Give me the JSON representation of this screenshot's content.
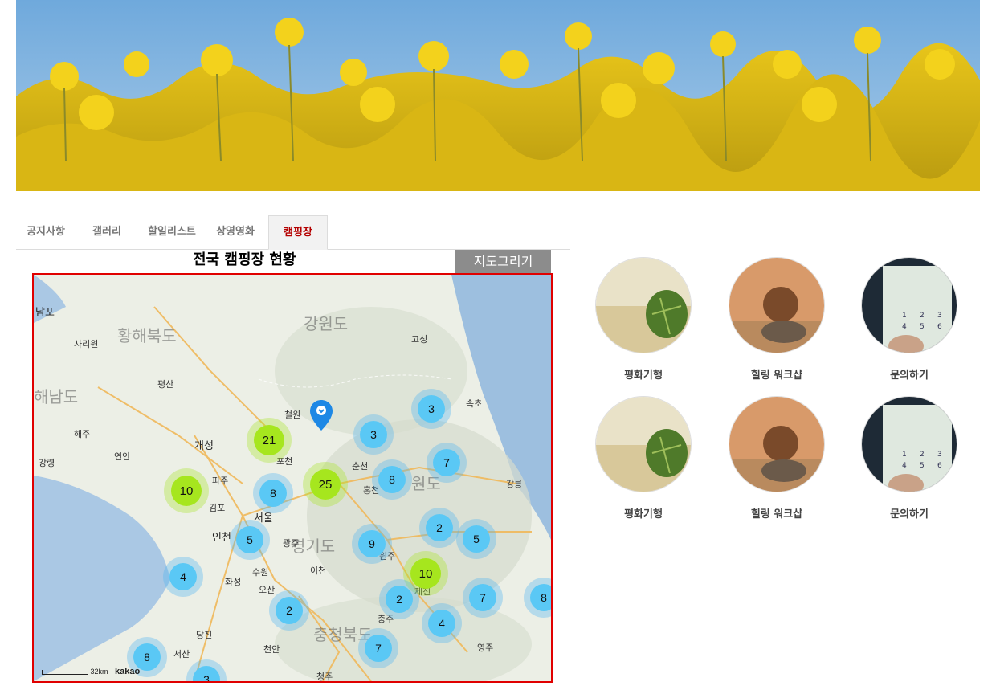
{
  "tabs": [
    {
      "label": "공지사항"
    },
    {
      "label": "갤러리"
    },
    {
      "label": "할일리스트"
    },
    {
      "label": "상영영화"
    },
    {
      "label": "캠핑장",
      "active": true
    }
  ],
  "map_section": {
    "title": "전국 캠핑장 현황",
    "draw_button": "지도그리기"
  },
  "map": {
    "provider": "kakao",
    "scale_label": "32km",
    "region_labels": [
      "황해북도",
      "강원도",
      "해남도",
      "경기도",
      "충청북도",
      "원도"
    ],
    "city_labels": [
      "남포",
      "사리원",
      "개성",
      "해주",
      "서울",
      "인천",
      "파주",
      "김포",
      "포천",
      "춘천",
      "속초",
      "강릉",
      "원주",
      "수원",
      "오산",
      "화성",
      "이천",
      "광주",
      "충주",
      "제천",
      "영주",
      "당진",
      "서산",
      "천안",
      "청주",
      "홍천",
      "철원",
      "연안",
      "강령",
      "평산",
      "고성"
    ],
    "clusters": [
      {
        "count": "3",
        "type": "small"
      },
      {
        "count": "21",
        "type": "big"
      },
      {
        "count": "3",
        "type": "small"
      },
      {
        "count": "7",
        "type": "small"
      },
      {
        "count": "10",
        "type": "big"
      },
      {
        "count": "8",
        "type": "small"
      },
      {
        "count": "25",
        "type": "big"
      },
      {
        "count": "8",
        "type": "small"
      },
      {
        "count": "2",
        "type": "small"
      },
      {
        "count": "5",
        "type": "small"
      },
      {
        "count": "5",
        "type": "small"
      },
      {
        "count": "9",
        "type": "small"
      },
      {
        "count": "4",
        "type": "small"
      },
      {
        "count": "10",
        "type": "big"
      },
      {
        "count": "2",
        "type": "small"
      },
      {
        "count": "7",
        "type": "small"
      },
      {
        "count": "8",
        "type": "small"
      },
      {
        "count": "2",
        "type": "small"
      },
      {
        "count": "4",
        "type": "small"
      },
      {
        "count": "7",
        "type": "small"
      },
      {
        "count": "8",
        "type": "small"
      },
      {
        "count": "3",
        "type": "small"
      }
    ]
  },
  "services": [
    {
      "label": "평화기행",
      "image": "leaf-on-sand"
    },
    {
      "label": "힐링 워크샵",
      "image": "stacked-stones"
    },
    {
      "label": "문의하기",
      "image": "phone-keypad"
    },
    {
      "label": "평화기행",
      "image": "leaf-on-sand"
    },
    {
      "label": "힐링 워크샵",
      "image": "stacked-stones"
    },
    {
      "label": "문의하기",
      "image": "phone-keypad"
    }
  ]
}
